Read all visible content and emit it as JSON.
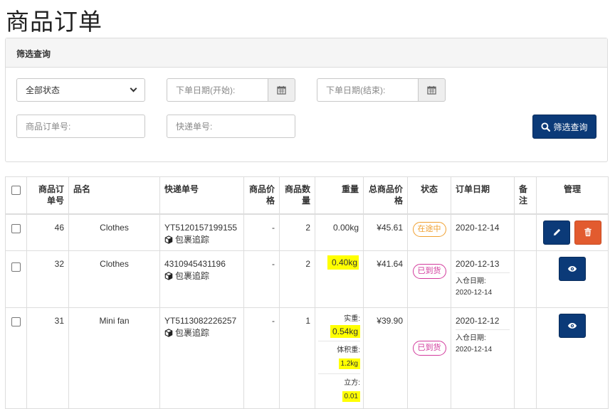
{
  "page": {
    "title": "商品订单"
  },
  "filter": {
    "title": "筛选查询",
    "status_select": "全部状态",
    "date_start_placeholder": "下单日期(开始):",
    "date_end_placeholder": "下单日期(结束):",
    "order_no_placeholder": "商品订单号:",
    "tracking_no_placeholder": "快递单号:",
    "search_label": "筛选查询"
  },
  "table": {
    "headers": {
      "order_no": "商品订单号",
      "product": "品名",
      "tracking": "快递单号",
      "price": "商品价格",
      "qty": "商品数量",
      "weight": "重量",
      "total": "总商品价格",
      "status": "状态",
      "date": "订单日期",
      "note": "备注",
      "manage": "管理"
    },
    "track_label": "包裹追踪",
    "rows": [
      {
        "id": "46",
        "product": "Clothes",
        "tracking": "YT5120157199155",
        "price": "-",
        "qty": "2",
        "weight": "0.00kg",
        "total": "¥45.61",
        "status": "在途中",
        "date": "2020-12-14"
      },
      {
        "id": "32",
        "product": "Clothes",
        "tracking": "4310945431196",
        "price": "-",
        "qty": "2",
        "weight": "0.40kg",
        "total": "¥41.64",
        "status": "已到货",
        "date": "2020-12-13",
        "warehouse_label": "入仓日期:",
        "warehouse_date": "2020-12-14"
      },
      {
        "id": "31",
        "product": "Mini fan",
        "tracking": "YT5113082226257",
        "price": "-",
        "qty": "1",
        "actual_label": "实重:",
        "actual_weight": "0.54kg",
        "volume_label": "体积重:",
        "volume_weight": "1.2kg",
        "cubic_label": "立方:",
        "cubic_value": "0.01",
        "total": "¥39.90",
        "status": "已到货",
        "date": "2020-12-12",
        "warehouse_label": "入仓日期:",
        "warehouse_date": "2020-12-14"
      }
    ]
  },
  "colors": {
    "primary": "#0b3a78",
    "danger": "#e25b2f",
    "in_transit": "#f0a030",
    "arrived": "#d23a9c",
    "highlight": "#ffff00"
  }
}
